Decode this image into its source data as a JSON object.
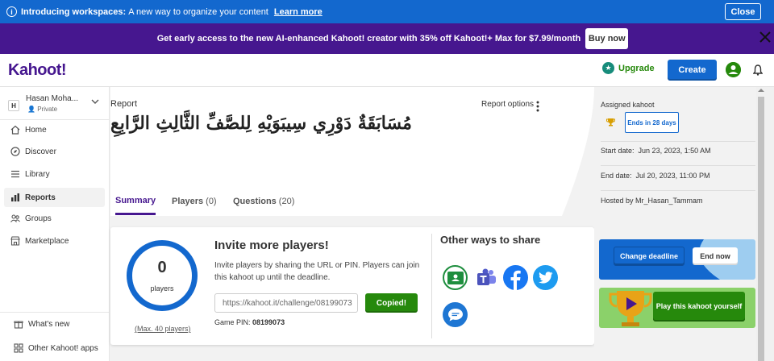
{
  "banner": {
    "title": "Introducing workspaces:",
    "text": "A new way to organize your content",
    "link": "Learn more",
    "close": "Close"
  },
  "promo": {
    "text": "Get early access to the new AI-enhanced Kahoot! creator with 35% off Kahoot!+ Max for $7.99/month",
    "button": "Buy now"
  },
  "header": {
    "logo": "Kahoot!",
    "upgrade": "Upgrade",
    "create": "Create"
  },
  "sidebar": {
    "user_initial": "H",
    "user_name": "Hasan Moha...",
    "user_visibility": "Private",
    "items": [
      {
        "label": "Home",
        "icon": "home-icon"
      },
      {
        "label": "Discover",
        "icon": "compass-icon"
      },
      {
        "label": "Library",
        "icon": "list-icon"
      },
      {
        "label": "Reports",
        "icon": "bar-chart-icon"
      },
      {
        "label": "Groups",
        "icon": "people-icon"
      },
      {
        "label": "Marketplace",
        "icon": "store-icon"
      }
    ],
    "active": "Reports",
    "bottom": [
      {
        "label": "What's new",
        "icon": "gift-icon"
      },
      {
        "label": "Other Kahoot! apps",
        "icon": "apps-icon"
      }
    ]
  },
  "report": {
    "label": "Report",
    "title": "مُسَابَقَةٌ دَوْرِي سِيبَوَيْهِ لِلصَّفِّ الثَّالِثِ الرَّابِعِ",
    "options": "Report options"
  },
  "tabs": [
    {
      "label": "Summary",
      "count": "",
      "selected": true
    },
    {
      "label": "Players",
      "count": "(0)",
      "selected": false
    },
    {
      "label": "Questions",
      "count": "(20)",
      "selected": false
    }
  ],
  "invite": {
    "player_count": "0",
    "players_label": "players",
    "max_players": "(Max. 40 players)",
    "title": "Invite more players!",
    "text": "Invite players by sharing the URL or PIN. Players can join this kahoot up until the deadline.",
    "url": "https://kahoot.it/challenge/08199073",
    "copied": "Copied!",
    "pin_label": "Game PIN:",
    "pin_value": "08199073",
    "other_ways": "Other ways to share"
  },
  "share_icons": [
    "google-classroom-icon",
    "teams-icon",
    "facebook-icon",
    "twitter-icon",
    "chat-icon"
  ],
  "assigned": {
    "label": "Assigned kahoot",
    "ends": "Ends in 28 days",
    "start_label": "Start date:",
    "start_value": "Jun 23, 2023, 1:50 AM",
    "end_label": "End date:",
    "end_value": "Jul 20, 2023, 11:00 PM",
    "hosted": "Hosted by Mr_Hasan_Tammam"
  },
  "actions": {
    "change_deadline": "Change deadline",
    "end_now": "End now",
    "play": "Play this kahoot yourself"
  },
  "colors": {
    "brand_purple": "#46178f",
    "blue": "#1368ce",
    "green": "#26890c"
  }
}
